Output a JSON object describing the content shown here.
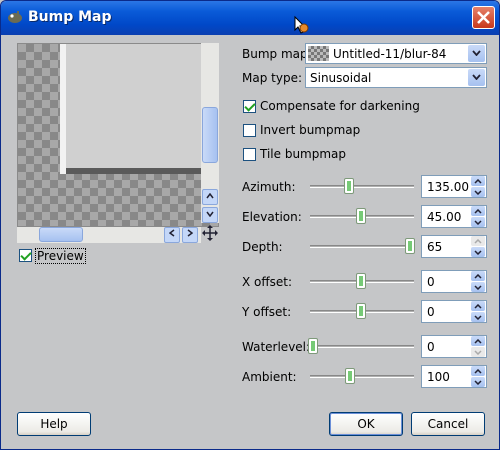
{
  "window": {
    "title": "Bump Map"
  },
  "preview": {
    "label": "Preview",
    "checked": true
  },
  "bump_map": {
    "label": "Bump map:",
    "value": "Untitled-11/blur-84"
  },
  "map_type": {
    "label": "Map type:",
    "value": "Sinusoidal"
  },
  "options": [
    {
      "label": "Compensate for darkening",
      "checked": true
    },
    {
      "label": "Invert bumpmap",
      "checked": false
    },
    {
      "label": "Tile bumpmap",
      "checked": false
    }
  ],
  "params": {
    "azimuth": {
      "label": "Azimuth:",
      "value": "135.00"
    },
    "elevation": {
      "label": "Elevation:",
      "value": "45.00"
    },
    "depth": {
      "label": "Depth:",
      "value": "65"
    },
    "x_offset": {
      "label": "X offset:",
      "value": "0"
    },
    "y_offset": {
      "label": "Y offset:",
      "value": "0"
    },
    "waterlevel": {
      "label": "Waterlevel:",
      "value": "0"
    },
    "ambient": {
      "label": "Ambient:",
      "value": "100"
    }
  },
  "buttons": {
    "help": "Help",
    "ok": "OK",
    "cancel": "Cancel"
  },
  "icons": {
    "app": "gimp-wilber-icon",
    "close": "close-icon",
    "cursor": "busy-cursor-icon",
    "move": "move-arrows-icon"
  },
  "colors": {
    "titlebar": "#0a5bd8",
    "close": "#c7381c",
    "check": "#21a121"
  }
}
